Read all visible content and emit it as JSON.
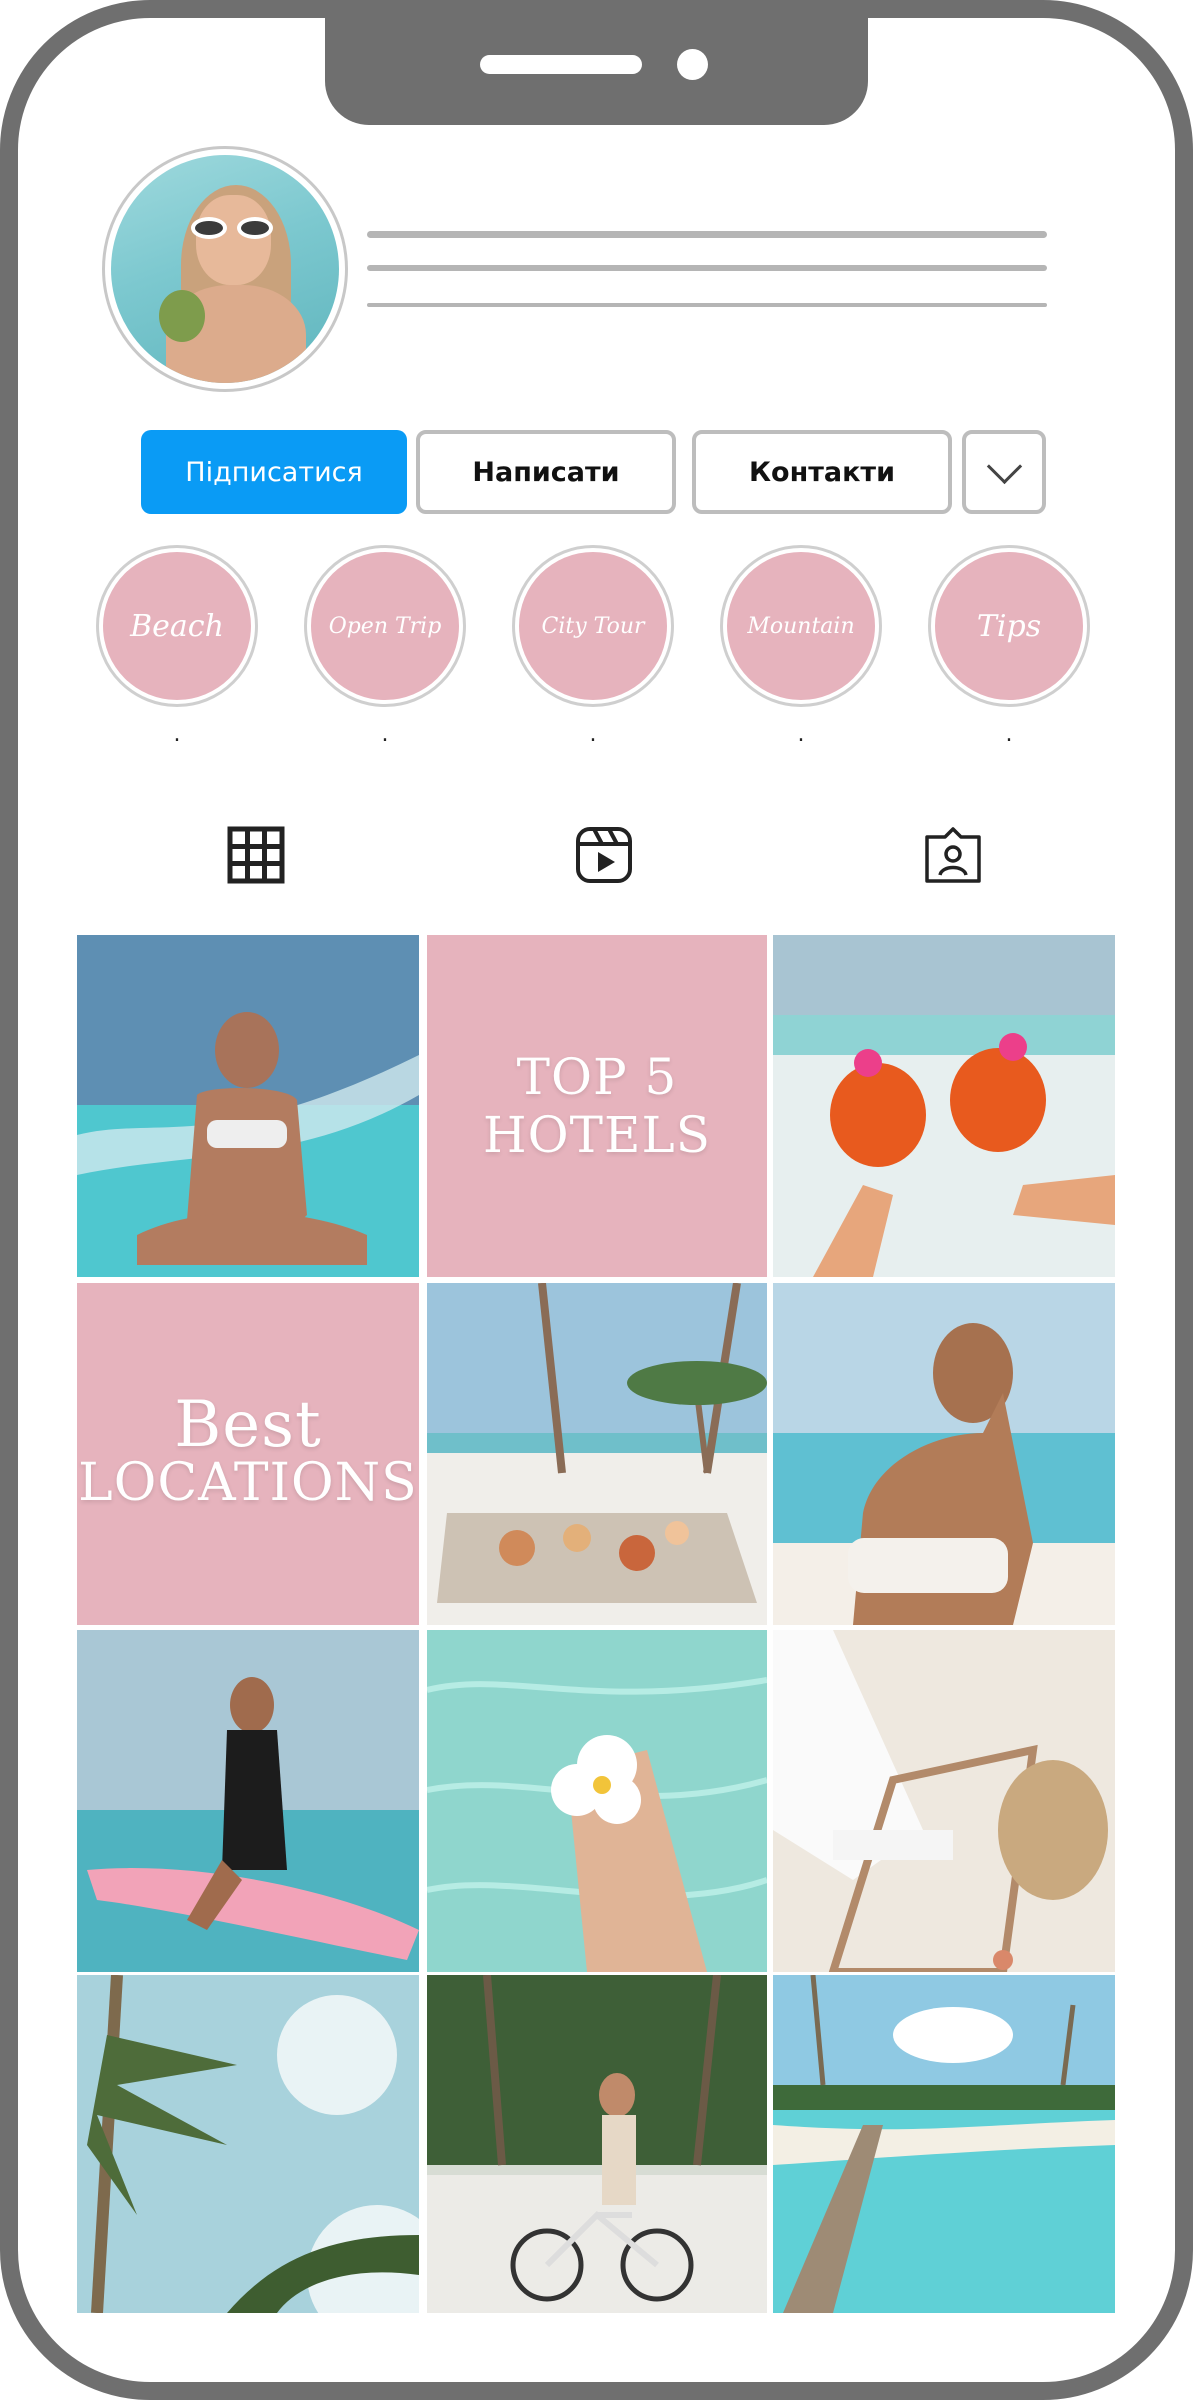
{
  "profile": {
    "follow_label": "Підписатися",
    "message_label": "Написати",
    "contacts_label": "Контакти"
  },
  "highlights": [
    {
      "label": "Beach",
      "dot": "."
    },
    {
      "label": "Open Trip",
      "dot": "."
    },
    {
      "label": "City Tour",
      "dot": "."
    },
    {
      "label": "Mountain",
      "dot": "."
    },
    {
      "label": "Tips",
      "dot": "."
    }
  ],
  "tabs": [
    "grid-icon",
    "reels-icon",
    "tagged-icon"
  ],
  "posts": {
    "top_hotels": {
      "line1": "TOP 5",
      "line2": "HOTELS"
    },
    "best_locations": {
      "line1": "Best",
      "line2": "LOCATIONS"
    }
  },
  "colors": {
    "follow_blue": "#0a9bf5",
    "highlight_pink": "#e6b3bd",
    "frame_gray": "#6f6f6f"
  }
}
